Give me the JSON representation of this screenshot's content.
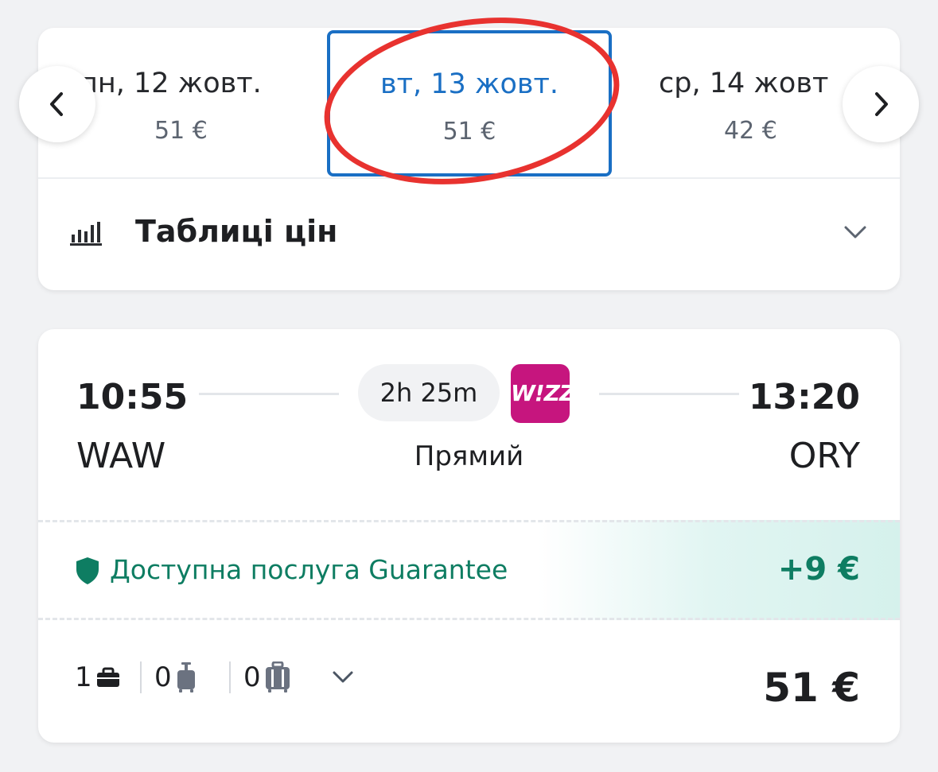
{
  "dates": {
    "prev": {
      "day": "пн, 12 жовт.",
      "price": "51 €"
    },
    "selected": {
      "day": "вт, 13 жовт.",
      "price": "51 €"
    },
    "next": {
      "day": "ср, 14 жовт",
      "price": "42 €"
    }
  },
  "price_table": {
    "label": "Таблиці цін"
  },
  "flight": {
    "departure_time": "10:55",
    "arrival_time": "13:20",
    "departure_airport": "WAW",
    "arrival_airport": "ORY",
    "duration": "2h 25m",
    "airline_logo_text": "W!ZZ",
    "stops": "Прямий"
  },
  "guarantee": {
    "label": "Доступна послуга Guarantee",
    "price": "+9 €"
  },
  "bags": {
    "personal": "1",
    "cabin": "0",
    "checked": "0"
  },
  "total_price": "51 €",
  "colors": {
    "accent_blue": "#1a6fc4",
    "highlight_red": "#e8322f",
    "guarantee_green": "#0e7d62",
    "airline_magenta": "#c6157e"
  }
}
